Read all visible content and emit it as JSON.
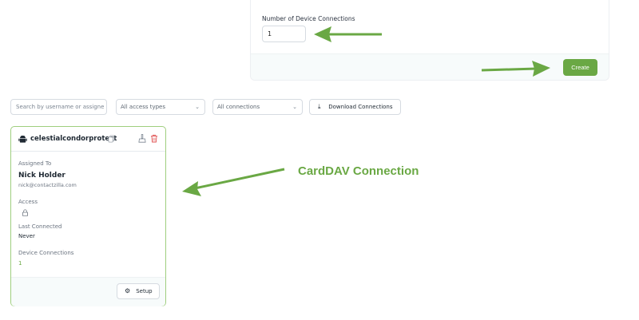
{
  "form": {
    "field_label": "Number of Device Connections",
    "field_value": "1",
    "create_label": "Create"
  },
  "filters": {
    "search_placeholder": "Search by username or assigne",
    "access_select": "All access types",
    "connections_select": "All connections",
    "download_label": "Download Connections"
  },
  "connection": {
    "name": "celestialcondorprotect",
    "assigned_to_label": "Assigned To",
    "assignee_name": "Nick Holder",
    "assignee_email": "nick@contactzilla.com",
    "access_label": "Access",
    "access_icon": "lock-icon",
    "last_connected_label": "Last Connected",
    "last_connected_value": "Never",
    "device_connections_label": "Device Connections",
    "device_connections_value": "1",
    "setup_label": "Setup"
  },
  "annotation": {
    "label": "CardDAV Connection",
    "color": "#6aa844"
  },
  "colors": {
    "accent": "#6aa844",
    "card_border": "#9fce7e",
    "delete": "#e05252"
  }
}
